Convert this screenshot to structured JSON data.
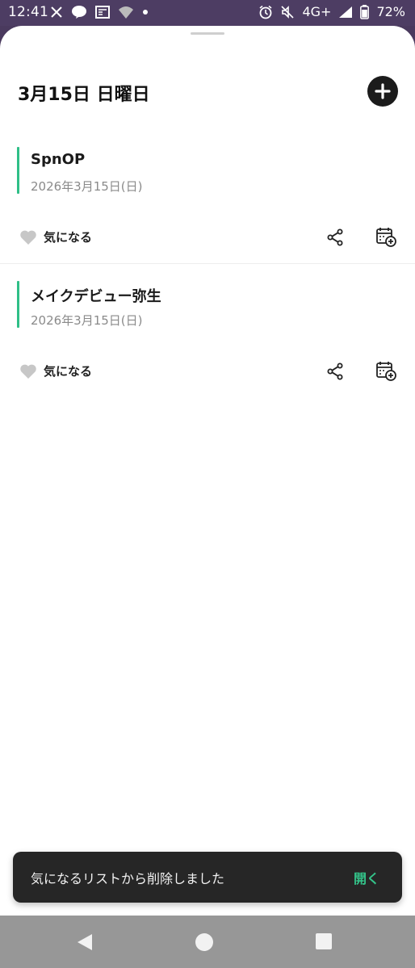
{
  "status_bar": {
    "time": "12:41",
    "left_icons": [
      "x-icon",
      "line-icon",
      "news-icon",
      "wifi-question-icon",
      "dot-icon"
    ],
    "network": "4G+",
    "battery": "72%"
  },
  "header": {
    "title": "3月15日 日曜日",
    "add_icon": "plus-icon"
  },
  "events": [
    {
      "name": "SpnOP",
      "date": "2026年3月15日(日)",
      "like_label": "気になる",
      "accent": "#2fbf87"
    },
    {
      "name": "メイクデビュー弥生",
      "date": "2026年3月15日(日)",
      "like_label": "気になる",
      "accent": "#2fbf87"
    }
  ],
  "snackbar": {
    "message": "気になるリストから削除しました",
    "action": "開く",
    "action_color": "#34c48a"
  },
  "nav": {
    "buttons": [
      "back-icon",
      "home-icon",
      "recents-icon"
    ]
  }
}
